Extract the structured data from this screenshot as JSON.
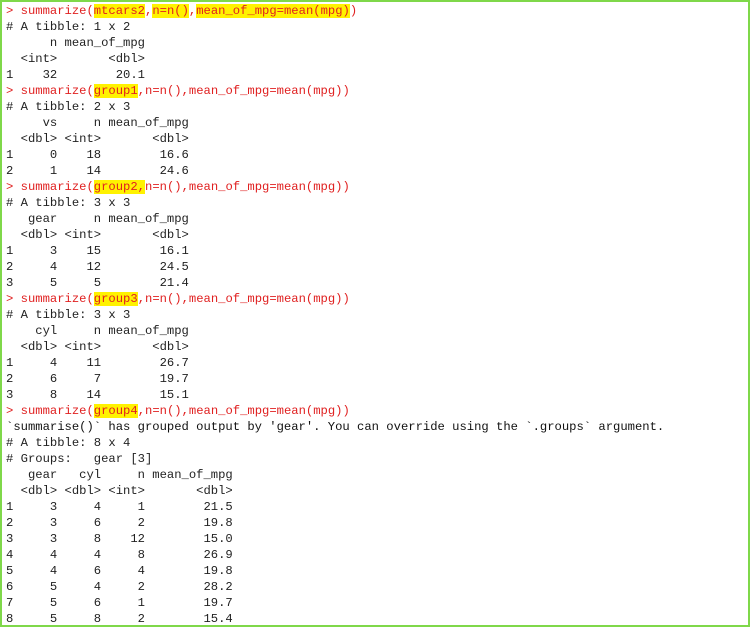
{
  "colors": {
    "command": "#e02020",
    "output": "#222222",
    "highlight": "#fff200",
    "frame": "#7fd84a"
  },
  "console": {
    "prompt": ">",
    "lines": [
      {
        "type": "cmd",
        "segments": [
          {
            "t": "summarize(",
            "hl": false
          },
          {
            "t": "mtcars2",
            "hl": true
          },
          {
            "t": ",",
            "hl": false
          },
          {
            "t": "n=n()",
            "hl": true
          },
          {
            "t": ",",
            "hl": false
          },
          {
            "t": "mean_of_mpg=mean(mpg)",
            "hl": true
          },
          {
            "t": ")",
            "hl": false
          }
        ]
      },
      {
        "type": "out",
        "text": "# A tibble: 1 x 2"
      },
      {
        "type": "out",
        "text": "      n mean_of_mpg"
      },
      {
        "type": "out",
        "text": "  <int>       <dbl>"
      },
      {
        "type": "out",
        "text": "1    32        20.1"
      },
      {
        "type": "cmd",
        "segments": [
          {
            "t": "summarize(",
            "hl": false
          },
          {
            "t": "group1",
            "hl": true
          },
          {
            "t": ",n=n(),mean_of_mpg=mean(mpg))",
            "hl": false
          }
        ]
      },
      {
        "type": "out",
        "text": "# A tibble: 2 x 3"
      },
      {
        "type": "out",
        "text": "     vs     n mean_of_mpg"
      },
      {
        "type": "out",
        "text": "  <dbl> <int>       <dbl>"
      },
      {
        "type": "out",
        "text": "1     0    18        16.6"
      },
      {
        "type": "out",
        "text": "2     1    14        24.6"
      },
      {
        "type": "cmd",
        "segments": [
          {
            "t": "summarize(",
            "hl": false
          },
          {
            "t": "group2,",
            "hl": true
          },
          {
            "t": "n=n(),mean_of_mpg=mean(mpg))",
            "hl": false
          }
        ]
      },
      {
        "type": "out",
        "text": "# A tibble: 3 x 3"
      },
      {
        "type": "out",
        "text": "   gear     n mean_of_mpg"
      },
      {
        "type": "out",
        "text": "  <dbl> <int>       <dbl>"
      },
      {
        "type": "out",
        "text": "1     3    15        16.1"
      },
      {
        "type": "out",
        "text": "2     4    12        24.5"
      },
      {
        "type": "out",
        "text": "3     5     5        21.4"
      },
      {
        "type": "cmd",
        "segments": [
          {
            "t": "summarize(",
            "hl": false
          },
          {
            "t": "group3",
            "hl": true
          },
          {
            "t": ",n=n(),mean_of_mpg=mean(mpg))",
            "hl": false
          }
        ]
      },
      {
        "type": "out",
        "text": "# A tibble: 3 x 3"
      },
      {
        "type": "out",
        "text": "    cyl     n mean_of_mpg"
      },
      {
        "type": "out",
        "text": "  <dbl> <int>       <dbl>"
      },
      {
        "type": "out",
        "text": "1     4    11        26.7"
      },
      {
        "type": "out",
        "text": "2     6     7        19.7"
      },
      {
        "type": "out",
        "text": "3     8    14        15.1"
      },
      {
        "type": "cmd",
        "segments": [
          {
            "t": "summarize(",
            "hl": false
          },
          {
            "t": "group4",
            "hl": true
          },
          {
            "t": ",n=n(),mean_of_mpg=mean(mpg))",
            "hl": false
          }
        ]
      },
      {
        "type": "msg",
        "text": "`summarise()` has grouped output by 'gear'. You can override using the `.groups` argument."
      },
      {
        "type": "out",
        "text": "# A tibble: 8 x 4"
      },
      {
        "type": "out",
        "text": "# Groups:   gear [3]"
      },
      {
        "type": "out",
        "text": "   gear   cyl     n mean_of_mpg"
      },
      {
        "type": "out",
        "text": "  <dbl> <dbl> <int>       <dbl>"
      },
      {
        "type": "out",
        "text": "1     3     4     1        21.5"
      },
      {
        "type": "out",
        "text": "2     3     6     2        19.8"
      },
      {
        "type": "out",
        "text": "3     3     8    12        15.0"
      },
      {
        "type": "out",
        "text": "4     4     4     8        26.9"
      },
      {
        "type": "out",
        "text": "5     4     6     4        19.8"
      },
      {
        "type": "out",
        "text": "6     5     4     2        28.2"
      },
      {
        "type": "out",
        "text": "7     5     6     1        19.7"
      },
      {
        "type": "out",
        "text": "8     5     8     2        15.4"
      }
    ]
  }
}
